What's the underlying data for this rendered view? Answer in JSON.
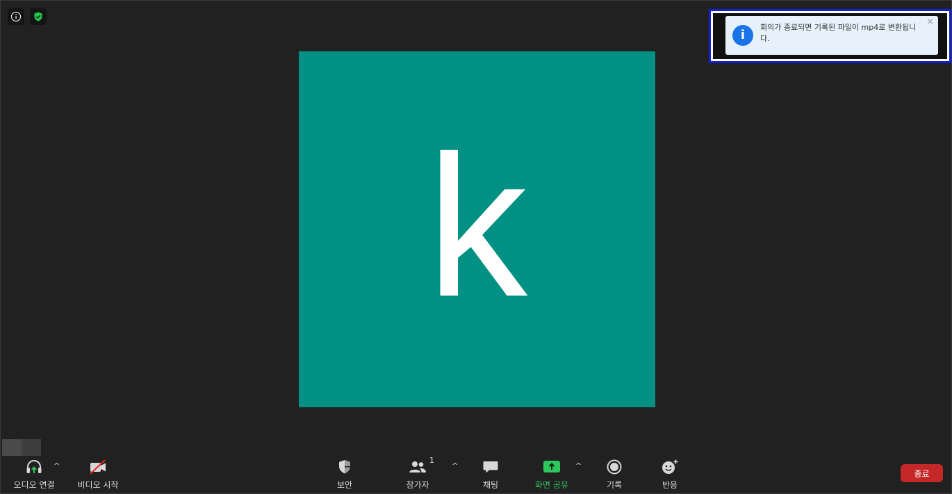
{
  "avatar": {
    "letter": "k",
    "color": "#009184"
  },
  "notification": {
    "message": "회의가 종료되면 기록된 파일이 mp4로 변환됩니다.",
    "icon": "info-icon",
    "close": "×"
  },
  "toolbar": {
    "audio": {
      "label": "오디오 연결",
      "icon": "headphones-icon"
    },
    "video": {
      "label": "비디오 시작",
      "icon": "video-off-icon"
    },
    "security": {
      "label": "보안",
      "icon": "shield-icon"
    },
    "participants": {
      "label": "참가자",
      "count": "1",
      "icon": "participants-icon"
    },
    "chat": {
      "label": "채팅",
      "icon": "chat-icon"
    },
    "share": {
      "label": "화면 공유",
      "icon": "share-screen-icon",
      "color": "#2ec55a"
    },
    "record": {
      "label": "기록",
      "icon": "record-icon"
    },
    "reactions": {
      "label": "반응",
      "icon": "reaction-icon"
    },
    "caret": "^",
    "end": {
      "label": "종료",
      "color": "#c52828"
    }
  }
}
